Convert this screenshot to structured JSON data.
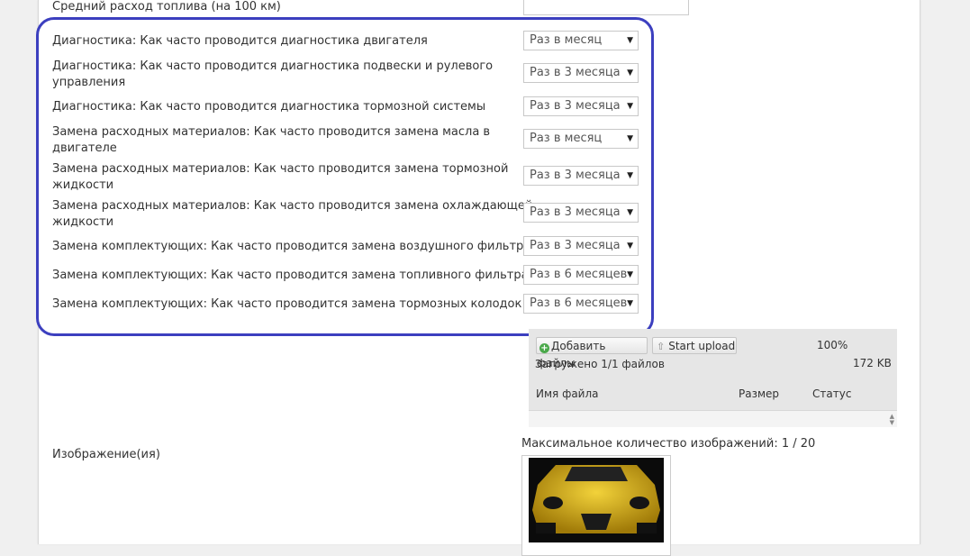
{
  "top_field": {
    "label": "Средний расход топлива (на 100 км)"
  },
  "maintenance": [
    {
      "label": "Диагностика: Как часто проводится диагностика двигателя",
      "value": "Раз в месяц"
    },
    {
      "label_line1": "Диагностика: Как часто проводится диагностика подвески и рулевого",
      "label_line2": "управления",
      "value": "Раз в 3 месяца"
    },
    {
      "label": "Диагностика: Как часто проводится диагностика тормозной системы",
      "value": "Раз в 3 месяца"
    },
    {
      "label_line1": "Замена расходных материалов: Как часто проводится замена масла в",
      "label_line2": "двигателе",
      "value": "Раз в месяц"
    },
    {
      "label_line1": "Замена расходных материалов: Как часто проводится замена тормозной",
      "label_line2": "жидкости",
      "value": "Раз в 3 месяца"
    },
    {
      "label_line1": "Замена расходных материалов: Как часто проводится замена охлаждающей",
      "label_line2": "жидкости",
      "value": "Раз в 3 месяца"
    },
    {
      "label": "Замена комплектующих: Как часто проводится замена воздушного фильтра",
      "value": "Раз в 3 месяца"
    },
    {
      "label": "Замена комплектующих: Как часто проводится замена топливного фильтра",
      "value": "Раз в 6 месяцев"
    },
    {
      "label": "Замена комплектующих: Как часто проводится замена тормозных колодок",
      "value": "Раз в 6 месяцев"
    }
  ],
  "uploader": {
    "add_files": "Добавить файлы",
    "start_upload": "Start upload",
    "percent": "100%",
    "uploaded": "Загружено 1/1 файлов",
    "total_size": "172 KB",
    "col_name": "Имя файла",
    "col_size": "Размер",
    "col_status": "Статус"
  },
  "images": {
    "label": "Изображение(ия)",
    "max_text": "Максимальное количество изображений: 1 / 20"
  },
  "colors": {
    "highlight": "#3c3fbf",
    "car": "#d9b21a"
  }
}
